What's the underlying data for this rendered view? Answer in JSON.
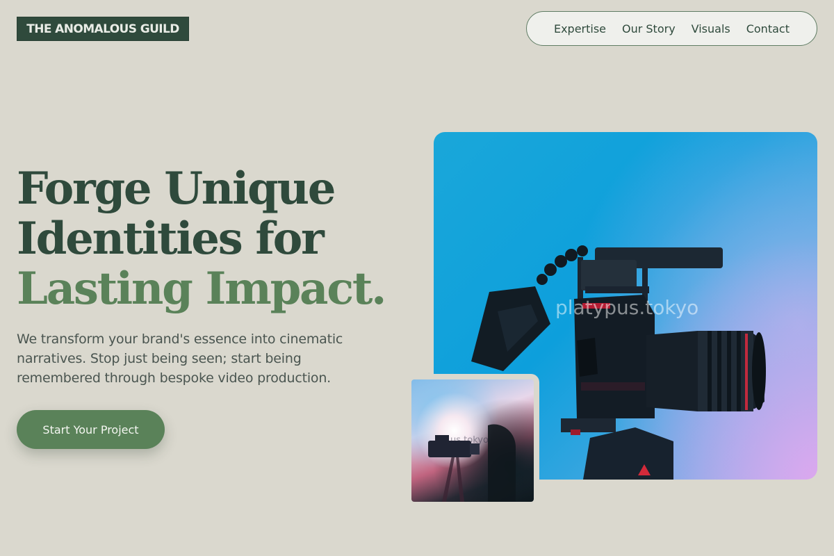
{
  "brand": {
    "logo_text": "THE ANOMALOUS GUILD"
  },
  "nav": {
    "items": [
      {
        "label": "Expertise"
      },
      {
        "label": "Our Story"
      },
      {
        "label": "Visuals"
      },
      {
        "label": "Contact"
      }
    ]
  },
  "hero": {
    "headline_line1": "Forge Unique",
    "headline_line2": "Identities for",
    "headline_line3": "Lasting Impact.",
    "description": "We transform your brand's essence into cinematic narratives. Stop just being seen; start being remembered through bespoke video production.",
    "cta_label": "Start Your Project"
  },
  "images": {
    "main_watermark": "platypus.tokyo",
    "thumb_watermark": "us.tokyo"
  },
  "colors": {
    "background": "#dad8ce",
    "primary_dark": "#2f4a3c",
    "accent_green": "#5a8259"
  }
}
